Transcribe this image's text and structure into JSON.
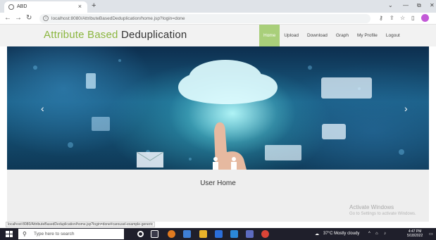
{
  "browser": {
    "tab_title": "ABD",
    "tab_close": "×",
    "new_tab": "+",
    "url": "localhost:8080/AttributeBasedDeduplication/home.jsp?login=done",
    "window_controls": [
      "⌄",
      "—",
      "⧉",
      "✕"
    ]
  },
  "site": {
    "title_light": "Attribute Based",
    "title_dark": "Deduplication",
    "accent_color": "#8bb63f",
    "nav": [
      "Home",
      "Upload",
      "Download",
      "Graph",
      "My Profile",
      "Logout"
    ],
    "active_nav": "Home"
  },
  "hero": {
    "prev_arrow": "‹",
    "next_arrow": "›"
  },
  "content": {
    "title": "User Home"
  },
  "watermark": {
    "line1": "Activate Windows",
    "line2": "Go to Settings to activate Windows."
  },
  "status_bar": {
    "url": "localhost:8080/AttributeBasedDeduplication/home.jsp?login=done#carousel-example-generic"
  },
  "taskbar": {
    "search_placeholder": "Type here to search",
    "weather": "37°C  Mostly cloudy",
    "time": "4:47 PM",
    "date": "5/18/2022"
  }
}
